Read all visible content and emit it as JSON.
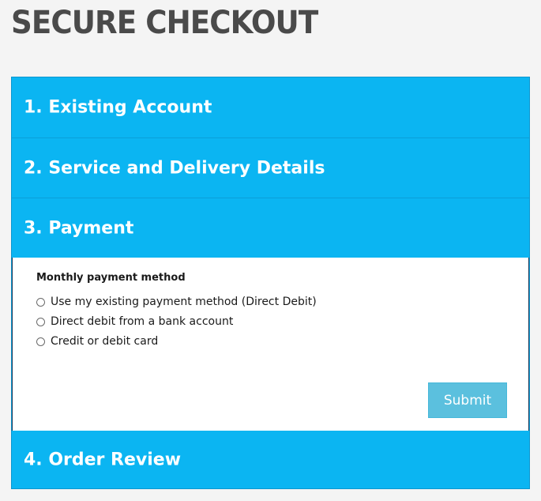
{
  "page": {
    "title": "SECURE CHECKOUT"
  },
  "accordion": {
    "sections": [
      {
        "label": "1. Existing Account",
        "expanded": false
      },
      {
        "label": "2. Service and Delivery Details",
        "expanded": false
      },
      {
        "label": "3. Payment",
        "expanded": true
      },
      {
        "label": "4. Order Review",
        "expanded": false
      }
    ]
  },
  "payment": {
    "method_label": "Monthly payment method",
    "options": [
      {
        "label": "Use my existing payment method (Direct Debit)",
        "selected": false
      },
      {
        "label": "Direct debit from a bank account",
        "selected": false
      },
      {
        "label": "Credit or debit card",
        "selected": false
      }
    ],
    "submit_label": "Submit"
  },
  "colors": {
    "header_background": "#0bb5f2",
    "submit_background": "#5bc0de",
    "title_text": "#4a4a4a",
    "page_background": "#f4f4f4"
  }
}
